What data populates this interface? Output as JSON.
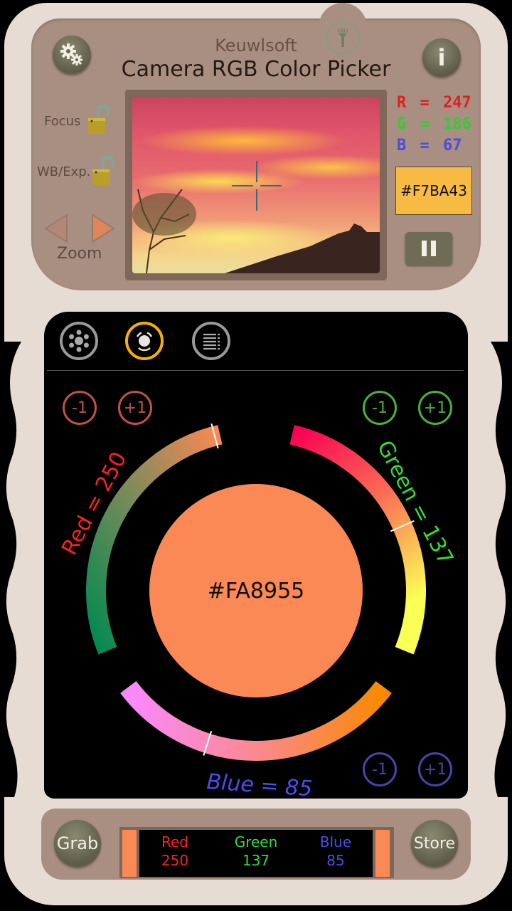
{
  "header": {
    "brand": "Keuwlsoft",
    "title": "Camera RGB Color Picker",
    "settings_icon": "gears-icon",
    "info_icon": "info-icon",
    "info_label": "i",
    "torch_icon": "flashlight-icon"
  },
  "camera_controls": {
    "focus_label": "Focus",
    "focus_locked": false,
    "wb_label": "WB/Exp.",
    "wb_locked": false,
    "zoom_label": "Zoom"
  },
  "sampled": {
    "r_label": "R",
    "g_label": "G",
    "b_label": "B",
    "eq": "=",
    "r": "247",
    "g": "186",
    "b": "67",
    "hex": "#F7BA43",
    "hex_color": "#f7ba43"
  },
  "modes": [
    {
      "name": "palette",
      "active": false
    },
    {
      "name": "dials",
      "active": true
    },
    {
      "name": "list",
      "active": false
    }
  ],
  "dials": {
    "red_label": "Red = 250",
    "green_label": "Green = 137",
    "blue_label": "Blue = 85",
    "red_value": 250,
    "green_value": 137,
    "blue_value": 85,
    "minus_label": "-1",
    "plus_label": "+1",
    "swatch_hex": "#FA8955",
    "swatch_color": "#fa8955"
  },
  "colors": {
    "red": "#ff2020",
    "green": "#33dd33",
    "blue": "#4c4cf0",
    "red_btn": "#c0504d",
    "green_btn": "#4caf3c",
    "blue_btn": "#4a44a8",
    "active_mode": "#f5b000"
  },
  "footer": {
    "grab_label": "Grab",
    "store_label": "Store",
    "red_title": "Red",
    "green_title": "Green",
    "blue_title": "Blue",
    "red_value": "250",
    "green_value": "137",
    "blue_value": "85"
  }
}
